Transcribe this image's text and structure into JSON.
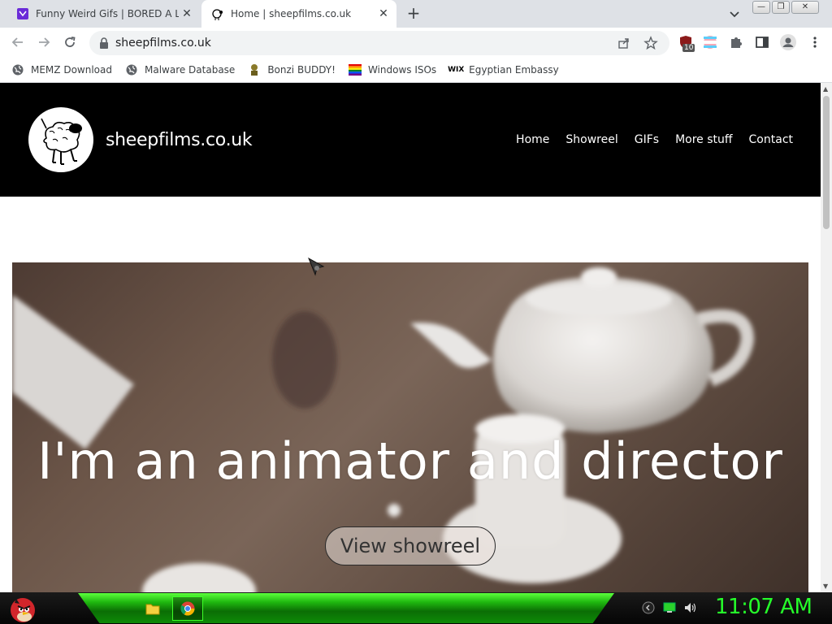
{
  "browser": {
    "tabs": [
      {
        "title": "Funny Weird Gifs | BORED A LOT",
        "active": false,
        "favicon": "bored-a-lot-icon"
      },
      {
        "title": "Home | sheepfilms.co.uk",
        "active": true,
        "favicon": "sheep-icon"
      }
    ],
    "new_tab_label": "+",
    "url": "sheepfilms.co.uk",
    "extension_badge": "10",
    "window_buttons": {
      "minimize": "—",
      "restore": "❐",
      "close": "✕"
    }
  },
  "bookmarks": [
    {
      "label": "MEMZ Download",
      "icon": "globe-icon"
    },
    {
      "label": "Malware Database",
      "icon": "globe-icon"
    },
    {
      "label": "Bonzi BUDDY!",
      "icon": "bonzi-icon"
    },
    {
      "label": "Windows ISOs",
      "icon": "windows-icon"
    },
    {
      "label": "Egyptian Embassy",
      "icon": "wix-icon"
    }
  ],
  "site": {
    "name": "sheepfilms.co.uk",
    "nav": [
      "Home",
      "Showreel",
      "GIFs",
      "More stuff",
      "Contact"
    ],
    "hero_title": "I'm an animator and director",
    "hero_button": "View showreel"
  },
  "taskbar": {
    "clock": "11:07 AM",
    "accent": "#25ff2a"
  }
}
